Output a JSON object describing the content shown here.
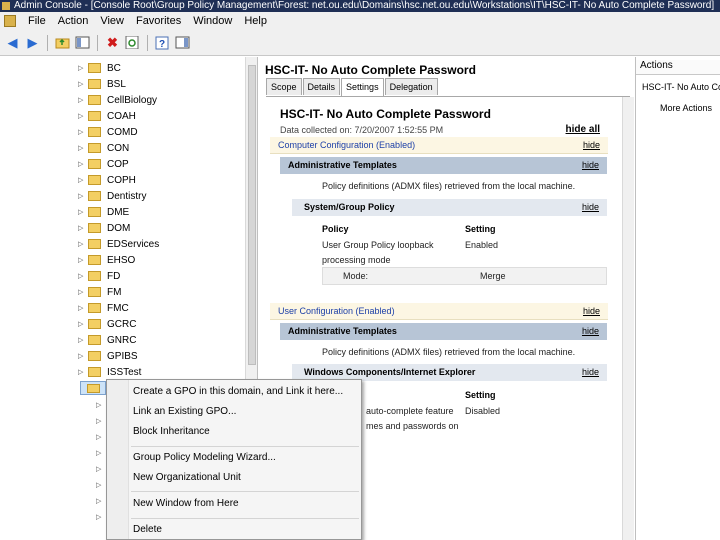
{
  "window": {
    "title": "Admin Console - [Console Root\\Group Policy Management\\Forest: net.ou.edu\\Domains\\hsc.net.ou.edu\\Workstations\\IT\\HSC-IT- No Auto Complete Password]"
  },
  "menu": [
    "File",
    "Action",
    "View",
    "Favorites",
    "Window",
    "Help"
  ],
  "toolbar_icons": [
    "back-arrow-icon",
    "forward-arrow-icon",
    "up-folder-icon",
    "show-hide-tree-icon",
    "delete-icon",
    "refresh-icon",
    "help-icon",
    "action-pane-icon"
  ],
  "tree": {
    "items": [
      "BC",
      "BSL",
      "CellBiology",
      "COAH",
      "COMD",
      "CON",
      "COP",
      "COPH",
      "Dentistry",
      "DME",
      "DOM",
      "EDServices",
      "EHSO",
      "FD",
      "FM",
      "FMC",
      "GCRC",
      "GNRC",
      "GPIBS",
      "ISSTest"
    ]
  },
  "content": {
    "title": "HSC-IT- No Auto Complete Password",
    "tabs": [
      "Scope",
      "Details",
      "Settings",
      "Delegation"
    ],
    "active_tab": "Settings"
  },
  "report": {
    "title": "HSC-IT- No Auto Complete Password",
    "date": "Data collected on: 7/20/2007 1:52:55 PM",
    "hide_all": "hide all",
    "hide": "hide",
    "computer_config": "Computer Configuration (Enabled)",
    "admin_templates": "Administrative Templates",
    "policy_defs": "Policy definitions (ADMX files) retrieved from the local machine.",
    "system_group_policy": "System/Group Policy",
    "col_policy": "Policy",
    "col_setting": "Setting",
    "loopback_line1": "User Group Policy loopback",
    "loopback_line2": "processing mode",
    "loopback_value": "Enabled",
    "mode_label": "Mode:",
    "mode_value": "Merge",
    "user_config": "User Configuration (Enabled)",
    "win_components": "Windows Components/Internet Explorer",
    "autocomplete_line1": "auto-complete feature",
    "autocomplete_line2": "mes and passwords on",
    "autocomplete_value": "Disabled"
  },
  "actions": {
    "header": "Actions",
    "subheader": "HSC-IT- No Auto Compl...",
    "more": "More Actions"
  },
  "context_menu": [
    "Create a GPO in this domain, and Link it here...",
    "Link an Existing GPO...",
    "Block Inheritance",
    "Group Policy Modeling Wizard...",
    "New Organizational Unit",
    "New Window from Here",
    "Delete"
  ]
}
